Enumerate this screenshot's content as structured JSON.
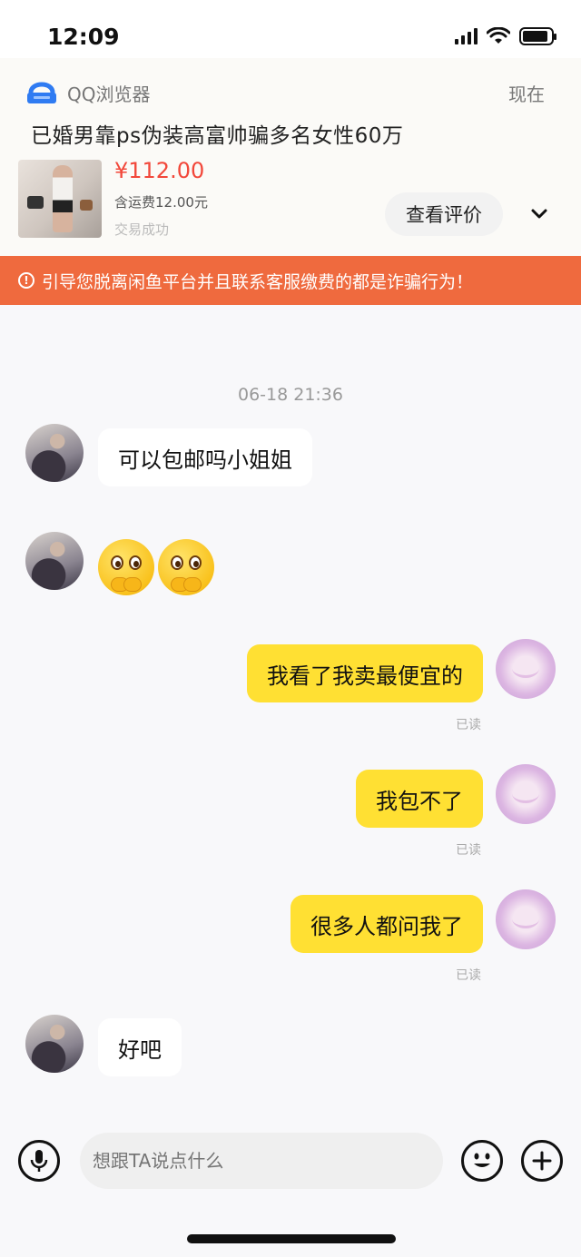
{
  "status_bar": {
    "time": "12:09",
    "battery_level": 0.9
  },
  "notification": {
    "app_name": "QQ浏览器",
    "time": "现在",
    "title": "已婚男靠ps伪装高富帅骗多名女性60万"
  },
  "product": {
    "price": "¥112.00",
    "shipping": "含运费12.00元",
    "status": "交易成功",
    "review_label": "查看评价"
  },
  "warning": {
    "text": "引导您脱离闲鱼平台并且联系客服缴费的都是诈骗行为！"
  },
  "chat": {
    "timestamp": "06-18 21:36",
    "messages": [
      {
        "from": "other",
        "text": "可以包邮吗小姐姐"
      },
      {
        "from": "other",
        "emoji": "pleading-face"
      },
      {
        "from": "me",
        "text": "我看了我卖最便宜的",
        "read": "已读"
      },
      {
        "from": "me",
        "text": "我包不了",
        "read": "已读"
      },
      {
        "from": "me",
        "text": "很多人都问我了",
        "read": "已读"
      },
      {
        "from": "other",
        "text": "好吧"
      }
    ]
  },
  "input": {
    "placeholder": "想跟TA说点什么"
  },
  "colors": {
    "accent_yellow": "#ffe033",
    "warning_orange": "#ef6a3e",
    "price_red": "#f2473a"
  }
}
